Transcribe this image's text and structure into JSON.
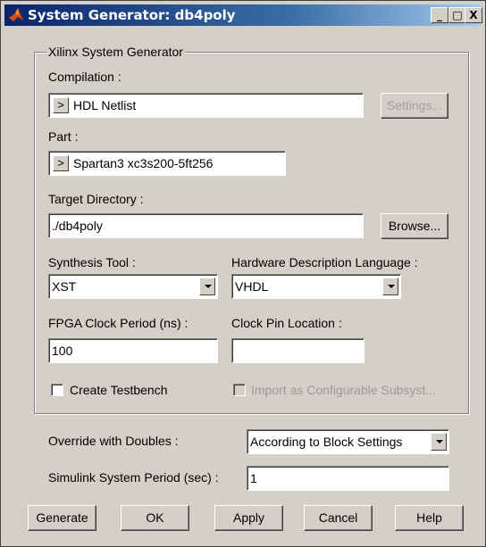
{
  "window": {
    "title": "System Generator: db4poly",
    "controls": {
      "minimize": "_",
      "maximize": "□",
      "close": "X"
    }
  },
  "group": {
    "title": "Xilinx System Generator"
  },
  "compilation": {
    "label": "Compilation :",
    "popup": ">",
    "value": "HDL Netlist",
    "settings_label": "Settings..."
  },
  "part": {
    "label": "Part :",
    "popup": ">",
    "value": "Spartan3  xc3s200-5ft256"
  },
  "target_directory": {
    "label": "Target Directory :",
    "value": "./db4poly",
    "browse_label": "Browse..."
  },
  "synthesis_tool": {
    "label": "Synthesis Tool :",
    "value": "XST"
  },
  "hdl": {
    "label": "Hardware Description Language :",
    "value": "VHDL"
  },
  "fpga_clock": {
    "label": "FPGA Clock Period (ns) :",
    "value": "100"
  },
  "clock_pin": {
    "label": "Clock Pin Location :",
    "value": ""
  },
  "create_testbench": {
    "label": "Create Testbench",
    "checked": false
  },
  "import_subsystem": {
    "label": "Import as Configurable Subsyst...",
    "checked": false
  },
  "override_doubles": {
    "label": "Override with Doubles :",
    "value": "According to Block Settings"
  },
  "sim_period": {
    "label": "Simulink System Period (sec) :",
    "value": "1"
  },
  "buttons": {
    "generate": "Generate",
    "ok": "OK",
    "apply": "Apply",
    "cancel": "Cancel",
    "help": "Help"
  },
  "colors": {
    "title_start": "#0a246a",
    "title_end": "#a6caf0",
    "face": "#d4d0c8",
    "disabled_text": "#9a9a9a"
  }
}
